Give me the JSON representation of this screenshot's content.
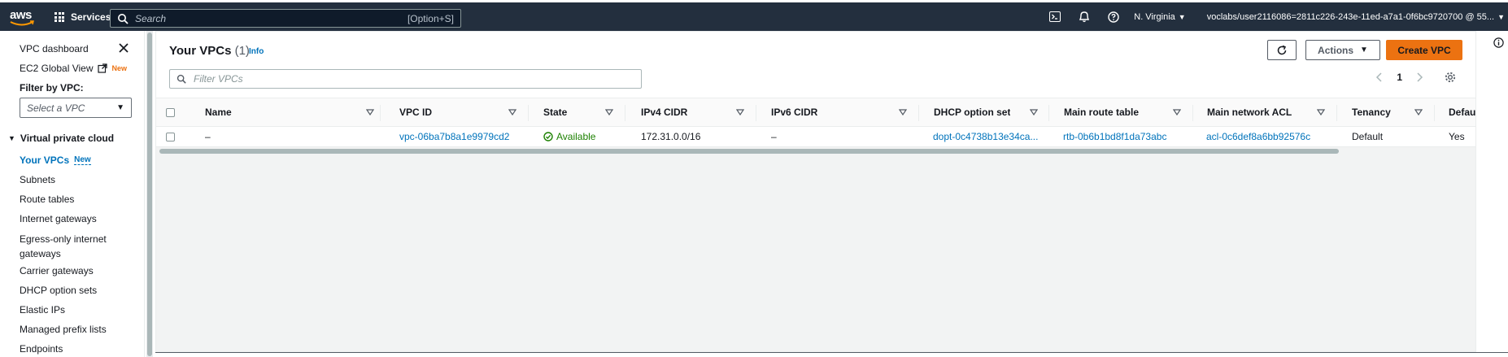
{
  "topnav": {
    "logo_text": "aws",
    "services_label": "Services",
    "search_placeholder": "Search",
    "search_shortcut": "[Option+S]",
    "region": "N. Virginia",
    "account": "voclabs/user2116086=2811c226-243e-11ed-a7a1-0f6bc9720700 @ 55..."
  },
  "sidebar": {
    "dashboard": "VPC dashboard",
    "global_view": "EC2 Global View",
    "global_view_badge": "New",
    "filter_label": "Filter by VPC:",
    "filter_placeholder": "Select a VPC",
    "section_title": "Virtual private cloud",
    "items": [
      {
        "label": "Your VPCs",
        "badge": "New"
      },
      {
        "label": "Subnets"
      },
      {
        "label": "Route tables"
      },
      {
        "label": "Internet gateways"
      },
      {
        "label": "Egress-only internet gateways"
      },
      {
        "label": "Carrier gateways"
      },
      {
        "label": "DHCP option sets"
      },
      {
        "label": "Elastic IPs"
      },
      {
        "label": "Managed prefix lists"
      },
      {
        "label": "Endpoints"
      }
    ]
  },
  "main": {
    "title": "Your VPCs",
    "count": "(1)",
    "info": "Info",
    "actions_label": "Actions",
    "create_label": "Create VPC",
    "filter_placeholder": "Filter VPCs",
    "page_number": "1",
    "columns": [
      "Name",
      "VPC ID",
      "State",
      "IPv4 CIDR",
      "IPv6 CIDR",
      "DHCP option set",
      "Main route table",
      "Main network ACL",
      "Tenancy",
      "Default"
    ],
    "rows": [
      {
        "name": "–",
        "vpc_id": "vpc-06ba7b8a1e9979cd2",
        "state": "Available",
        "ipv4": "172.31.0.0/16",
        "ipv6": "–",
        "dhcp": "dopt-0c4738b13e34ca...",
        "route_table": "rtb-0b6b1bd8f1da73abc",
        "acl": "acl-0c6def8a6bb92576c",
        "tenancy": "Default",
        "default": "Yes"
      }
    ]
  },
  "colors": {
    "nav_bg": "#232f3e",
    "link": "#0073bb",
    "primary": "#ec7211",
    "success": "#1d8102"
  }
}
